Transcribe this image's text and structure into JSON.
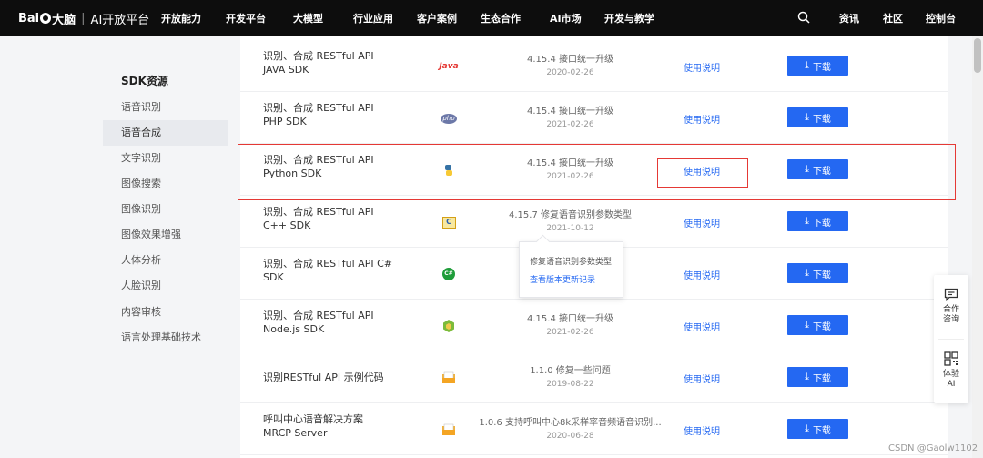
{
  "nav": {
    "logo_text": "Bai",
    "logo_suffix": "大脑",
    "platform": "AI开放平台",
    "items": [
      "开放能力",
      "开发平台",
      "大模型",
      "行业应用",
      "客户案例",
      "生态合作",
      "AI市场",
      "开发与教学"
    ],
    "right_items": [
      "资讯",
      "社区",
      "控制台"
    ]
  },
  "sidebar": {
    "title": "SDK资源",
    "items": [
      {
        "label": "语音识别",
        "active": false
      },
      {
        "label": "语音合成",
        "active": true
      },
      {
        "label": "文字识别",
        "active": false
      },
      {
        "label": "图像搜索",
        "active": false
      },
      {
        "label": "图像识别",
        "active": false
      },
      {
        "label": "图像效果增强",
        "active": false
      },
      {
        "label": "人体分析",
        "active": false
      },
      {
        "label": "人脸识别",
        "active": false
      },
      {
        "label": "内容审核",
        "active": false
      },
      {
        "label": "语言处理基础技术",
        "active": false
      }
    ]
  },
  "table": {
    "rows": [
      {
        "name1": "识别、合成 RESTful API",
        "name2": "JAVA SDK",
        "icon": "java-icon",
        "icon_text": "Java",
        "version": "4.15.4 接口统一升级",
        "date": "2020-02-26",
        "doc": "使用说明",
        "download": "下载"
      },
      {
        "name1": "识别、合成 RESTful API",
        "name2": "PHP SDK",
        "icon": "php-icon",
        "icon_text": "php",
        "version": "4.15.4 接口统一升级",
        "date": "2021-02-26",
        "doc": "使用说明",
        "download": "下载"
      },
      {
        "name1": "识别、合成 RESTful API",
        "name2": "Python SDK",
        "icon": "python-icon",
        "icon_text": "",
        "version": "4.15.4 接口统一升级",
        "date": "2021-02-26",
        "doc": "使用说明",
        "download": "下载"
      },
      {
        "name1": "识别、合成 RESTful API",
        "name2": "C++ SDK",
        "icon": "cpp-icon",
        "icon_text": "C",
        "version": "4.15.7 修复语音识别参数类型",
        "date": "2021-10-12",
        "doc": "使用说明",
        "download": "下载"
      },
      {
        "name1": "识别、合成 RESTful API C#",
        "name2": "SDK",
        "icon": "csharp-icon",
        "icon_text": "C#",
        "version": "",
        "date": "",
        "doc": "使用说明",
        "download": "下载"
      },
      {
        "name1": "识别、合成 RESTful API",
        "name2": "Node.js SDK",
        "icon": "nodejs-icon",
        "icon_text": "",
        "version": "4.15.4 接口统一升级",
        "date": "2021-02-26",
        "doc": "使用说明",
        "download": "下载"
      },
      {
        "name1": "识别RESTful API 示例代码",
        "name2": "",
        "icon": "code-file-icon",
        "icon_text": "",
        "version": "1.1.0 修复一些问题",
        "date": "2019-08-22",
        "doc": "使用说明",
        "download": "下载"
      },
      {
        "name1": "呼叫中心语音解决方案",
        "name2": "MRCP Server",
        "icon": "server-file-icon",
        "icon_text": "",
        "version": "1.0.6 支持呼叫中心8k采样率音频语音识别...",
        "date": "2020-06-28",
        "doc": "使用说明",
        "download": "下载"
      }
    ]
  },
  "tooltip": {
    "text": "修复语音识别参数类型",
    "link": "查看版本更新记录"
  },
  "float_panel": {
    "consult": "合作\n咨询",
    "consult_l1": "合作",
    "consult_l2": "咨询",
    "trial_l1": "体验",
    "trial_l2": "AI"
  },
  "watermark": "CSDN @Gaolw1102",
  "colors": {
    "accent": "#2468f2",
    "nav_bg": "#0d0d0d",
    "highlight": "#e53935"
  }
}
